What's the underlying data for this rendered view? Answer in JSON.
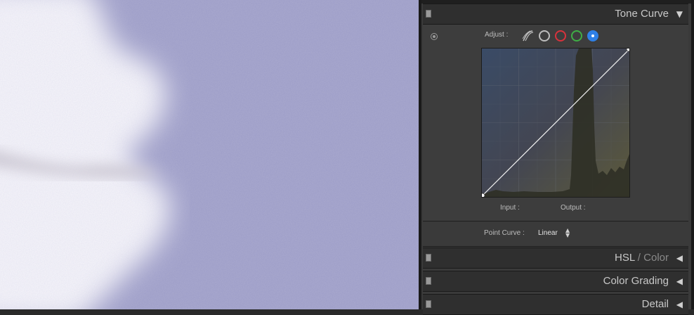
{
  "panels": {
    "tone_curve": {
      "title": "Tone Curve",
      "adjust_label": "Adjust :",
      "channels": [
        {
          "name": "parametric",
          "icon": "parametric-curve-icon"
        },
        {
          "name": "rgb",
          "color": "#bdbdbd"
        },
        {
          "name": "red",
          "color": "#d9323c"
        },
        {
          "name": "green",
          "color": "#3fae46"
        },
        {
          "name": "blue",
          "color": "#2f80e6",
          "selected": true
        }
      ],
      "input_label": "Input :",
      "output_label": "Output :",
      "point_curve_label": "Point Curve :",
      "point_curve_value": "Linear"
    },
    "hsl": {
      "title_main": "HSL",
      "title_sep": " / ",
      "title_dim": "Color"
    },
    "color_grading": {
      "title": "Color Grading"
    },
    "detail": {
      "title": "Detail"
    }
  },
  "colors": {
    "canvas_background": "#9b9bc6",
    "panel_background": "#3a3a3a",
    "blue_channel_accent": "#2f80e6"
  },
  "icons": [
    "target-adjust-icon",
    "parametric-curve-icon",
    "collapse-arrow-icon",
    "expand-arrow-icon",
    "updown-stepper-icon",
    "panel-toggle-icon"
  ]
}
